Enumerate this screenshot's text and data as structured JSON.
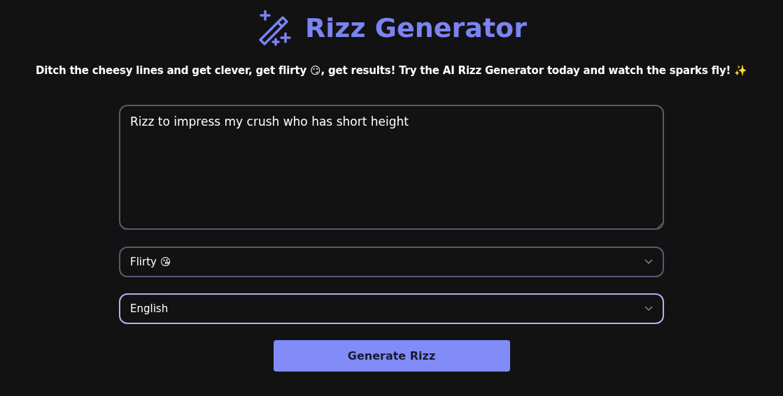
{
  "header": {
    "title": "Rizz Generator"
  },
  "tagline": "Ditch the cheesy lines and get clever, get flirty 😏, get results! Try the AI Rizz Generator today and watch the sparks fly! ✨",
  "prompt": {
    "value": "Rizz to impress my crush who has short height"
  },
  "selects": [
    {
      "value": "Flirty 😘",
      "focused": false
    },
    {
      "value": "English",
      "focused": true
    }
  ],
  "button": {
    "label": "Generate Rizz"
  }
}
